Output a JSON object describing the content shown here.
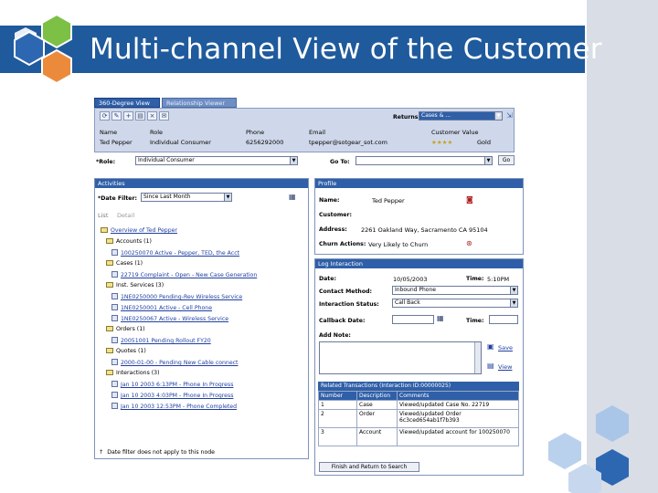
{
  "slide": {
    "title": "Multi-channel View of the Customer"
  },
  "colors": {
    "title_bar": "#1f5a9c",
    "panel_header": "#2f5fa8",
    "hex_blue": "#2d67b2",
    "hex_green": "#7cc045",
    "hex_orange": "#ec8a3c",
    "hex_light": "#a9c6e8"
  },
  "tabs": [
    "360-Degree View",
    "Relationship Viewer"
  ],
  "header": {
    "returns_label": "Returns",
    "returns_value": "Cases & ...",
    "columns": [
      "Name",
      "Role",
      "Phone",
      "Email",
      "Customer Value"
    ],
    "values": [
      "Ted Pepper",
      "Individual Consumer",
      "6256292000",
      "tpepper@sotgear_sot.com",
      "Gold"
    ],
    "role_label": "*Role:",
    "role_value": "Individual Consumer",
    "go_to_label": "Go To:",
    "go_label": "Go"
  },
  "activities": {
    "title": "Activities",
    "date_filter_label": "*Date Filter:",
    "date_filter_value": "Since Last Month",
    "tree_tabs": [
      "List",
      "Detail"
    ],
    "overview": "Overview of Ted Pepper",
    "accounts": "Accounts (1)",
    "account_item": "100250070 Active - Pepper, TED, the Acct",
    "cases": "Cases (1)",
    "case_item": "22719 Complaint - Open - New Case Generation",
    "inst_services": "Inst. Services (3)",
    "service_items": [
      "1NE0250000 Pending-Rev Wireless Service",
      "1NE0250001 Active - Cell Phone",
      "1NE0250067 Active - Wireless Service"
    ],
    "orders": "Orders (1)",
    "order_item": "20051001 Pending Rollout FY20",
    "quotes": "Quotes (1)",
    "quote_item": "2000-01-00 - Pending New Cable connect",
    "interactions": "Interactions (3)",
    "interaction_items": [
      "Jan 10 2003 6:13PM - Phone In Progress",
      "Jan 10 2003 4:03PM - Phone In Progress",
      "Jan 10 2003 12:53PM - Phone Completed"
    ],
    "footnote": "Date filter does not apply to this node"
  },
  "profile": {
    "title": "Profile",
    "name_label": "Name:",
    "name_value": "Ted Pepper",
    "customer_label": "Customer:",
    "address_label": "Address:",
    "address_value": "2261 Oakland Way, Sacramento CA 95104",
    "churn_label": "Churn Actions:",
    "churn_value": "Very Likely to Churn"
  },
  "log_interaction": {
    "title": "Log Interaction",
    "date_label": "Date:",
    "date_value": "10/05/2003",
    "time_label": "Time:",
    "time_value": "5:10PM",
    "contact_method_label": "Contact Method:",
    "contact_method_value": "Inbound Phone",
    "interaction_status_label": "Interaction Status:",
    "interaction_status_value": "Call Back",
    "callback_date_label": "Callback Date:",
    "callback_time_label": "Time:",
    "add_note_label": "Add Note:",
    "save_label": "Save",
    "view_label": "View",
    "related_title": "Related Transactions (Interaction ID:00000025)",
    "related_headers": [
      "Number",
      "Description",
      "Comments"
    ],
    "related_rows": [
      [
        "1",
        "Case",
        "Viewed/updated Case No. 22719"
      ],
      [
        "2",
        "Order",
        "Viewed/updated Order 6c3ced654ab1f7b393"
      ],
      [
        "3",
        "Account",
        "Viewed/updated account for 100250070"
      ]
    ],
    "finish_button": "Finish and Return to Search"
  }
}
